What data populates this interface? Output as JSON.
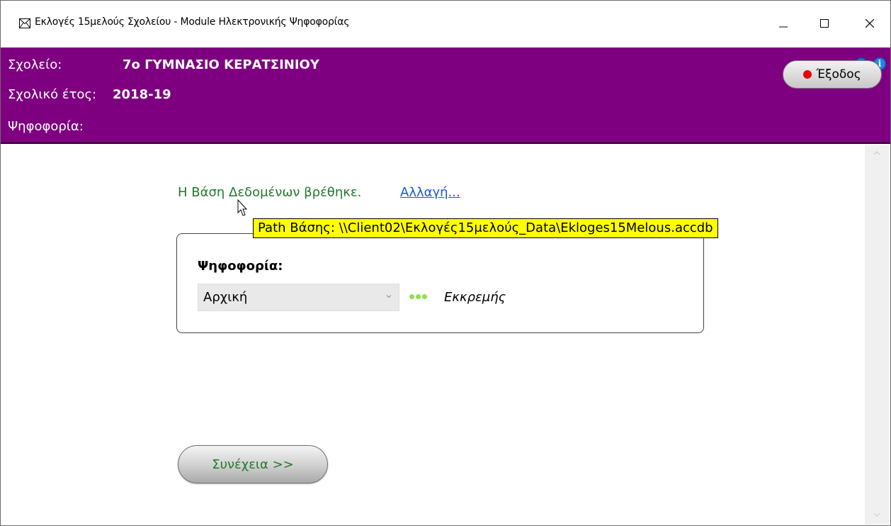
{
  "window": {
    "title": "Εκλογές 15μελούς Σχολείου - Module Ηλεκτρονικής Ψηφοφορίας",
    "app_icon": "envelope-icon",
    "controls": [
      "minimize-icon",
      "maximize-icon",
      "close-icon"
    ]
  },
  "header": {
    "school_label": "Σχολείο:",
    "school_name": "7ο ΓΥΜΝΑΣΙΟ ΚΕΡΑΤΣΙΝΙΟΥ",
    "year_label": "Σχολικό έτος:",
    "year_value": "2018-19",
    "vote_label": "Ψηφοφορία:",
    "help_glyph": "?",
    "info_glyph": "i",
    "exit_label": "Έξοδος",
    "background_color": "#7e0080"
  },
  "main": {
    "db_status": "Η Βάση Δεδομένων βρέθηκε.",
    "change_link": "Αλλαγή...",
    "tooltip": "Path Βάσης: \\\\Client02\\Εκλογές15μελούς_Data\\Ekloges15Melous.accdb",
    "vote_section_label": "Ψηφοφορία:",
    "vote_select_value": "Αρχική",
    "vote_status": "Εκκρεμής",
    "status_color": "#8fe04a",
    "continue_label": "Συνέχεια >>"
  }
}
